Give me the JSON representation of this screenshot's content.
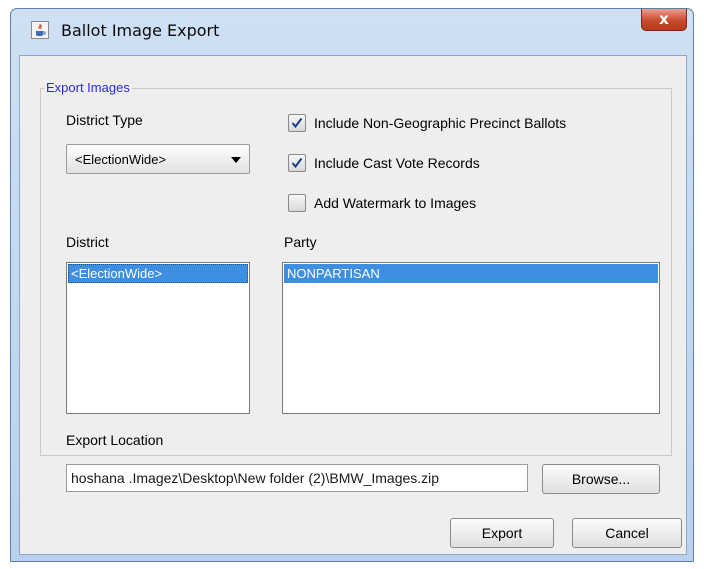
{
  "window": {
    "title": "Ballot Image Export",
    "close_label": "x"
  },
  "group": {
    "title": "Export Images"
  },
  "district_type": {
    "label": "District Type",
    "selected": "<ElectionWide>"
  },
  "options": [
    {
      "label": "Include Non-Geographic Precinct Ballots",
      "checked": true
    },
    {
      "label": "Include Cast Vote Records",
      "checked": true
    },
    {
      "label": "Add Watermark to Images",
      "checked": false
    }
  ],
  "district": {
    "label": "District",
    "items": [
      "<ElectionWide>"
    ]
  },
  "party": {
    "label": "Party",
    "items": [
      "NONPARTISAN"
    ]
  },
  "export_location": {
    "label": "Export Location",
    "value": "hoshana .Imagez\\Desktop\\New folder (2)\\BMW_Images.zip"
  },
  "buttons": {
    "browse": "Browse...",
    "export": "Export",
    "cancel": "Cancel"
  },
  "colors": {
    "group_title": "#2a2ad6",
    "selection": "#3e8ee2",
    "close_button": "#c94a2f"
  }
}
